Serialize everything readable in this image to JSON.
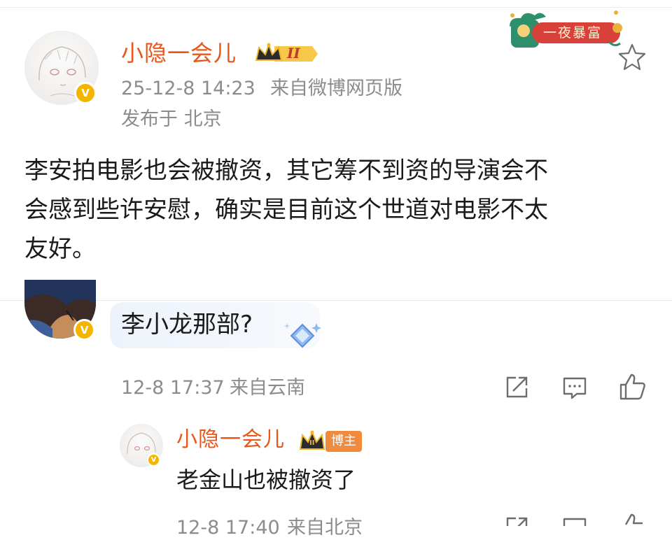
{
  "post": {
    "author": "小隐一会儿",
    "level_badge": "II",
    "timestamp": "25-12-8 14:23",
    "source": "来自微博网页版",
    "location": "发布于 北京",
    "text_lines": [
      "李安拍电影也会被撤资，其它筹不到资的导演会不",
      "会感到些许安慰，确实是目前这个世道对电影不太",
      "友好。"
    ],
    "decoration_badge": "一夜暴富"
  },
  "comment": {
    "text": "李小龙那部?",
    "timestamp": "12-8 17:37",
    "source": "来自云南"
  },
  "reply": {
    "author": "小隐一会儿",
    "tag": "博主",
    "level_badge": "II",
    "text": "老金山也被撤资了",
    "timestamp_partial": "12-8 17:40",
    "source_partial": "来自北京"
  },
  "colors": {
    "name": "#e8561a",
    "meta": "#8c8c8c",
    "verified": "#f4b400",
    "festive_green": "#2f8f6a",
    "festive_red": "#d8413a"
  }
}
